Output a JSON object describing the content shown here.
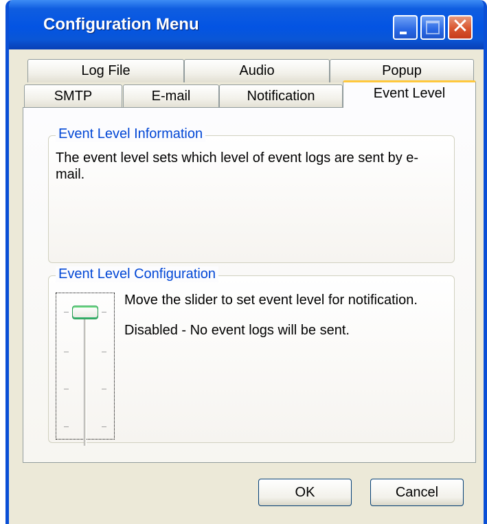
{
  "window": {
    "title": "Configuration Menu"
  },
  "tabs": {
    "row1": [
      {
        "label": "Log File"
      },
      {
        "label": "Audio"
      },
      {
        "label": "Popup"
      }
    ],
    "row2": [
      {
        "label": "SMTP"
      },
      {
        "label": "E-mail"
      },
      {
        "label": "Notification"
      },
      {
        "label": "Event Level",
        "active": true
      }
    ]
  },
  "info_group": {
    "title": "Event Level Information",
    "text": "The event level sets which level of event logs are sent by e-mail."
  },
  "config_group": {
    "title": "Event Level Configuration",
    "instruction": "Move the slider to set event level for notification.",
    "status": "Disabled - No event logs will be sent.",
    "slider_level": 0,
    "slider_max": 3
  },
  "buttons": {
    "ok": "OK",
    "cancel": "Cancel"
  },
  "colors": {
    "titlebar": "#0354e3",
    "group_title": "#0046d5",
    "active_tab_accent": "#ffc83c",
    "window_face": "#ece9d8"
  }
}
